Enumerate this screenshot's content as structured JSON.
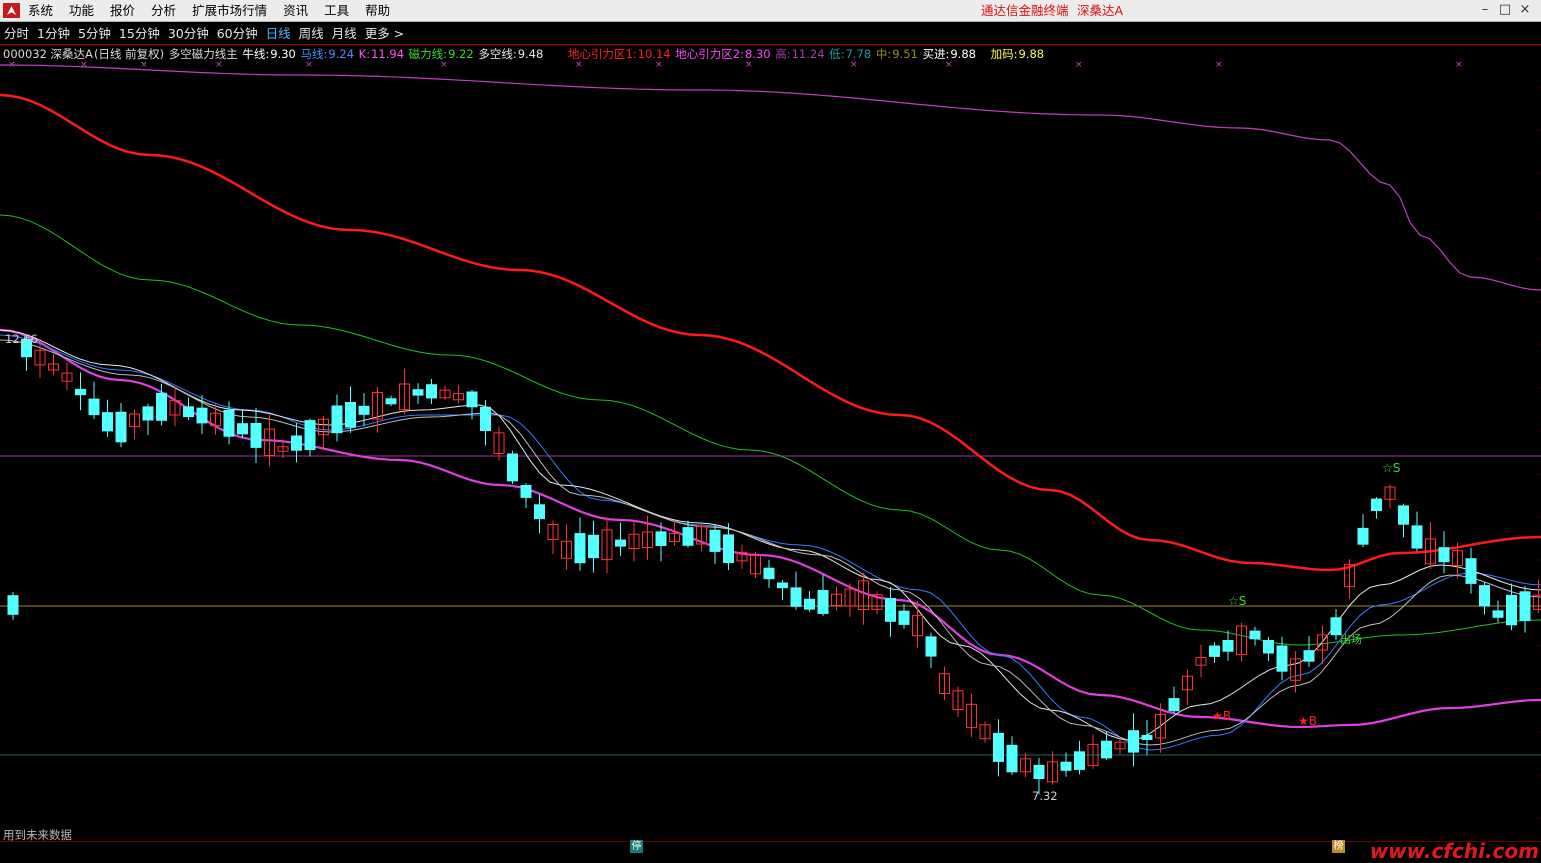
{
  "menubar": {
    "items": [
      "系统",
      "功能",
      "报价",
      "分析",
      "扩展市场行情",
      "资讯",
      "工具",
      "帮助"
    ],
    "brand_terminal": "通达信金融终端",
    "brand_stock": "深桑达A"
  },
  "periods": {
    "items": [
      "分时",
      "1分钟",
      "5分钟",
      "15分钟",
      "30分钟",
      "60分钟",
      "日线",
      "周线",
      "月线",
      "更多 >"
    ],
    "active_index": 6
  },
  "infobar": {
    "code_name": "000032 深桑达A",
    "mode": "(日线 前复权)",
    "indicator_name": "多空磁力线主",
    "niu_label": "牛线:",
    "niu_value": "9.30",
    "ma_label": "马线:",
    "ma_value": "9.24",
    "k_label": "K:",
    "k_value": "11.94",
    "cili_label": "磁力线:",
    "cili_value": "9.22",
    "duokong_label": "多空线:",
    "duokong_value": "9.48",
    "dixin1_label": "地心引力区1:",
    "dixin1_value": "10.14",
    "dixin2_label": "地心引力区2:",
    "dixin2_value": "8.30",
    "gao_label": "高:",
    "gao_value": "11.24",
    "di_label": "低:",
    "di_value": "7.78",
    "zhong_label": "中:",
    "zhong_value": "9.51",
    "maijin_label": "买进:",
    "maijin_value": "9.88",
    "jiama_label": "加码:",
    "jiama_value": "9.88"
  },
  "chart_labels": {
    "high": "12.66",
    "low": "7.32",
    "signal_s": "☆S",
    "signal_b": "★B",
    "chuchang": "出场"
  },
  "colors": {
    "up": "#ff3232",
    "down": "#54ffff",
    "line_red": "#ff1a1a",
    "line_green": "#22c022",
    "line_magenta": "#e040e0",
    "line_purple": "#c040c0",
    "line_blue": "#3a7aff",
    "line_white": "#e8e8e8",
    "line_olive": "#a08a30",
    "line_teal": "#1a6a6a"
  },
  "footer": {
    "warning": "用到未来数据",
    "marker_stop": "停",
    "marker_list": "榜",
    "watermark": "www.cfchi.com"
  }
}
